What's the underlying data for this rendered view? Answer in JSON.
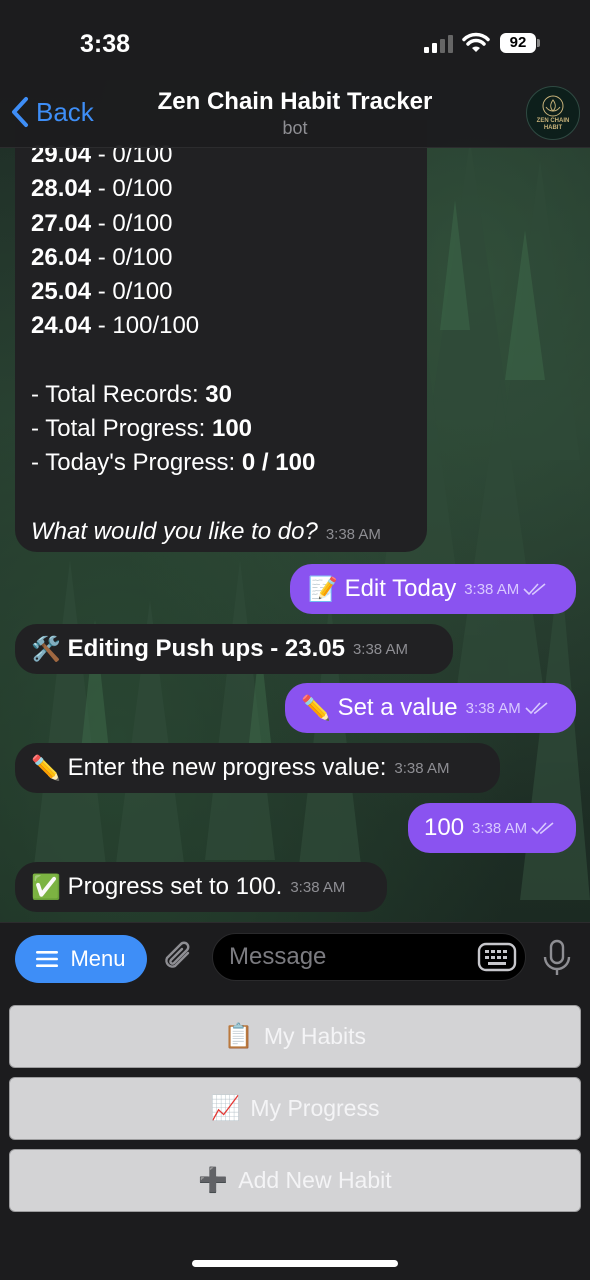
{
  "status_bar": {
    "time": "3:38",
    "battery": "92"
  },
  "header": {
    "back_label": "Back",
    "title": "Zen Chain Habit Tracker",
    "subtitle": "bot",
    "avatar_text_1": "ZEN CHAIN",
    "avatar_text_2": "HABIT"
  },
  "stats_message": {
    "records": [
      {
        "date": "29.04",
        "value": "- 0/100"
      },
      {
        "date": "28.04",
        "value": "- 0/100"
      },
      {
        "date": "27.04",
        "value": "- 0/100"
      },
      {
        "date": "26.04",
        "value": "- 0/100"
      },
      {
        "date": "25.04",
        "value": "- 0/100"
      },
      {
        "date": "24.04",
        "value": "- 100/100"
      }
    ],
    "total_records_label": "- Total Records: ",
    "total_records_value": "30",
    "total_progress_label": "- Total Progress: ",
    "total_progress_value": "100",
    "today_progress_label": "- Today's Progress: ",
    "today_progress_value": "0 / 100",
    "question": "What would you like to do?",
    "time": "3:38 AM"
  },
  "messages": [
    {
      "from": "user",
      "emoji": "📝",
      "text": "Edit Today",
      "time": "3:38 AM"
    },
    {
      "from": "bot",
      "emoji": "🛠️",
      "text": "Editing Push ups - 23.05",
      "bold": true,
      "time": "3:38 AM"
    },
    {
      "from": "user",
      "emoji": "✏️",
      "text": "Set a value",
      "time": "3:38 AM"
    },
    {
      "from": "bot",
      "emoji": "✏️",
      "text": "Enter the new progress value:",
      "time": "3:38 AM"
    },
    {
      "from": "user",
      "emoji": "",
      "text": "100",
      "time": "3:38 AM"
    },
    {
      "from": "bot",
      "emoji": "✅",
      "text": "Progress set to 100.",
      "time": "3:38 AM"
    }
  ],
  "input_bar": {
    "menu_label": "Menu",
    "placeholder": "Message"
  },
  "keyboard": {
    "buttons": [
      {
        "icon": "📋",
        "label": "My Habits"
      },
      {
        "icon": "📈",
        "label": "My Progress"
      },
      {
        "icon": "➕",
        "label": "Add New Habit"
      }
    ]
  },
  "colors": {
    "accent_blue": "#3e8ef7",
    "outgoing_bubble": "#8a53f0",
    "incoming_bubble": "#212123"
  }
}
